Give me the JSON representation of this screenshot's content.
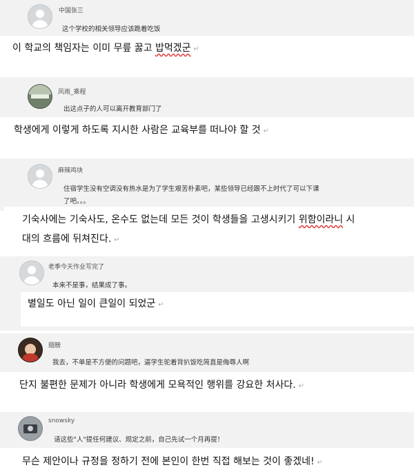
{
  "comments": [
    {
      "username": "中国张三",
      "text": "这个学校的相关领导应该跪着吃饭",
      "avatar_icon": "default-avatar-icon",
      "translation": {
        "before": "이 학교의 책임자는 이미 무릎 꿇고 ",
        "marked": "밥먹겠군",
        "after": ""
      }
    },
    {
      "username": "风雨_乘程",
      "text": "出这点子的人可以离开教育部门了",
      "avatar_icon": "landscape-avatar-icon",
      "translation": {
        "before": "학생에게 이렇게 하도록 지시한 사람은 교육부를 떠나야 할 것",
        "marked": "",
        "after": ""
      }
    },
    {
      "username": "麻辣鸡块",
      "text_lines": [
        "住宿学生没有空调没有热水是为了学生艰苦朴素吧，某些领导已经跟不上时代了可以下课",
        "了吧。。。"
      ],
      "avatar_icon": "default-avatar-icon",
      "translation_lines": [
        {
          "before": "기숙사에는 기숙사도, 온수도 없는데 모든 것이 학생들을 고생시키기 ",
          "marked": "위함이라니",
          "after": " 시"
        },
        {
          "before": "대의 흐름에 뒤쳐진다.",
          "marked": "",
          "after": ""
        }
      ]
    },
    {
      "username": "老季今天作业写完了",
      "text": "本来不是事，结果成了事。",
      "avatar_icon": "default-avatar-icon",
      "translation": {
        "before": "별일도 아닌 일이 큰일이 되었군",
        "marked": "",
        "after": ""
      }
    },
    {
      "username": "翅膀",
      "text": "我去，不单是不方便的问题吧，逼学生驼着背扒饭吃简直是侮辱人啊",
      "avatar_icon": "child-photo-avatar-icon",
      "translation": {
        "before": "단지 불편한 문제가 아니라 학생에게 모욕적인 행위를 강요한 처사다.",
        "marked": "",
        "after": ""
      }
    },
    {
      "username": "snowsky",
      "text": "请这些\"人\"提任何建议、规定之前，自己先试一个月再提！",
      "avatar_icon": "camera-photo-avatar-icon",
      "translation": {
        "before": "무슨 제안이나 규정을 정하기 전에 본인이 한번 직접 해보는 것이 좋겠네!",
        "marked": "",
        "after": ""
      }
    }
  ],
  "paragraph_mark": "↵"
}
